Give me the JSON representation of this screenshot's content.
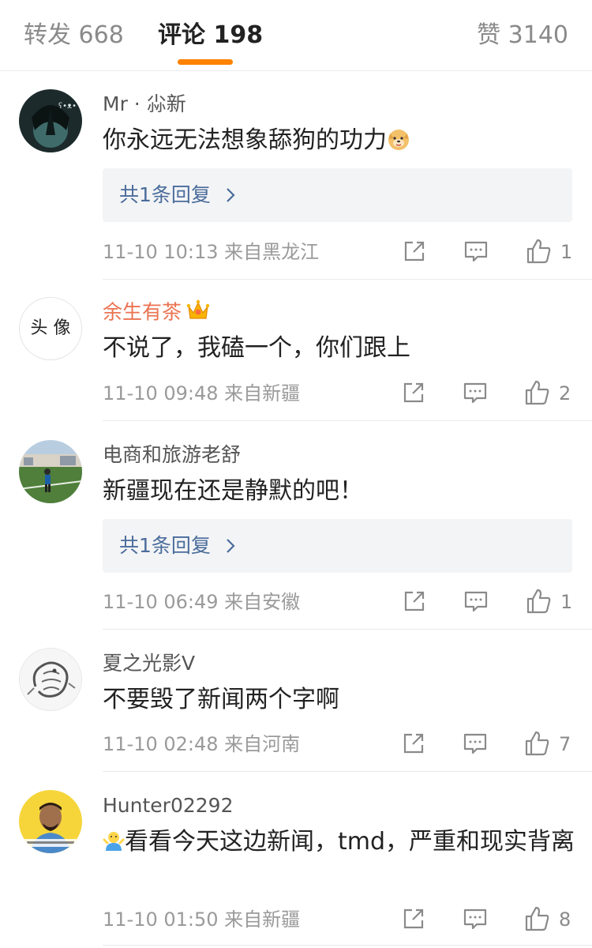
{
  "tabs": {
    "repost": "转发 668",
    "comment": "评论 198",
    "like": "赞 3140"
  },
  "colors": {
    "accent": "#ff8200",
    "link": "#4a6c9b",
    "vip_name": "#eb7350"
  },
  "comments": [
    {
      "name": "Mr · 尛新",
      "text": "你永远无法想象舔狗的功力",
      "emoji": "doge-emoji",
      "reply": "共1条回复",
      "time": "11-10 10:13",
      "location": "来自黑龙江",
      "likes": "1"
    },
    {
      "name": "余生有茶",
      "badge": "crown-icon",
      "avatar_text": "头 像",
      "text": "不说了，我磕一个，你们跟上",
      "time": "11-10 09:48",
      "location": "来自新疆",
      "likes": "2"
    },
    {
      "name": "电商和旅游老舒",
      "text": "新疆现在还是静默的吧！",
      "reply": "共1条回复",
      "time": "11-10 06:49",
      "location": "来自安徽",
      "likes": "1"
    },
    {
      "name": "夏之光影V",
      "text": "不要毁了新闻两个字啊",
      "time": "11-10 02:48",
      "location": "来自河南",
      "likes": "7"
    },
    {
      "name": "Hunter02292",
      "emoji": "shrug-emoji",
      "text": "看看今天这边新闻，tmd，严重和现实背离",
      "time": "11-10 01:50",
      "location": "来自新疆",
      "likes": "8"
    }
  ]
}
